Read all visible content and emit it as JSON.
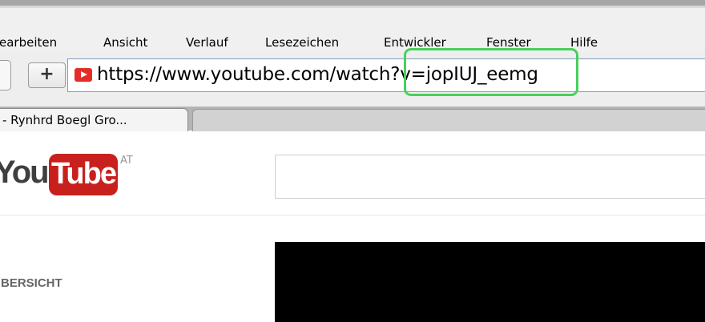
{
  "menu": {
    "items": [
      "earbeiten",
      "Ansicht",
      "Verlauf",
      "Lesezeichen",
      "Entwickler",
      "Fenster",
      "Hilfe"
    ]
  },
  "toolbar": {
    "new_tab_symbol": "+",
    "url": "https://www.youtube.com/watch?v=jopIUJ_eemg",
    "favicon": "youtube-favicon-icon",
    "highlight_color": "#47d05c"
  },
  "tabs": [
    {
      "title": "- Rynhrd Boegl Gro..."
    }
  ],
  "youtube": {
    "logo_you": "You",
    "logo_tube": "Tube",
    "logo_region": "AT",
    "brand_color": "#c8201d",
    "sidebar_heading": "BERSICHT"
  }
}
